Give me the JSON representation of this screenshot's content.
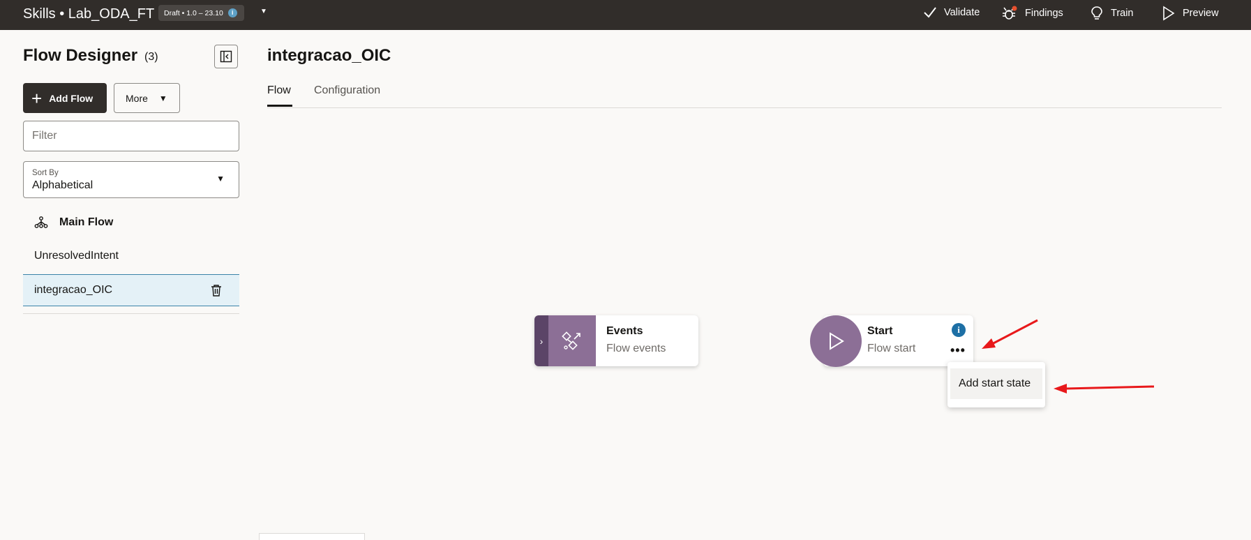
{
  "header": {
    "app_title": "Skills • Lab_ODA_FT",
    "badge_text": "Draft • 1.0 – 23.10",
    "info_glyph": "i",
    "actions": [
      {
        "label": "Validate",
        "icon": "check-icon"
      },
      {
        "label": "Findings",
        "icon": "bug-icon"
      },
      {
        "label": "Train",
        "icon": "lightbulb-icon"
      },
      {
        "label": "Preview",
        "icon": "play-icon"
      }
    ]
  },
  "sidebar": {
    "title": "Flow Designer",
    "count": "(3)",
    "add_flow_label": "Add Flow",
    "more_label": "More",
    "filter_placeholder": "Filter",
    "sort_label": "Sort By",
    "sort_value": "Alphabetical",
    "flows": [
      {
        "label": "Main Flow",
        "type": "main"
      },
      {
        "label": "UnresolvedIntent",
        "type": "normal"
      },
      {
        "label": "integracao_OIC",
        "type": "selected"
      }
    ]
  },
  "main": {
    "title": "integracao_OIC",
    "tabs": [
      {
        "label": "Flow",
        "active": true
      },
      {
        "label": "Configuration",
        "active": false
      }
    ]
  },
  "canvas": {
    "events_node": {
      "title": "Events",
      "subtitle": "Flow events",
      "handle": "›"
    },
    "start_node": {
      "title": "Start",
      "subtitle": "Flow start",
      "info": "i",
      "dots": "•••"
    },
    "menu": {
      "items": [
        "Add start state"
      ]
    }
  },
  "colors": {
    "topbar": "#312d2a",
    "node_accent": "#8c6f96",
    "annotation_arrow": "#e8191b",
    "selection": "#e4f1f7"
  }
}
